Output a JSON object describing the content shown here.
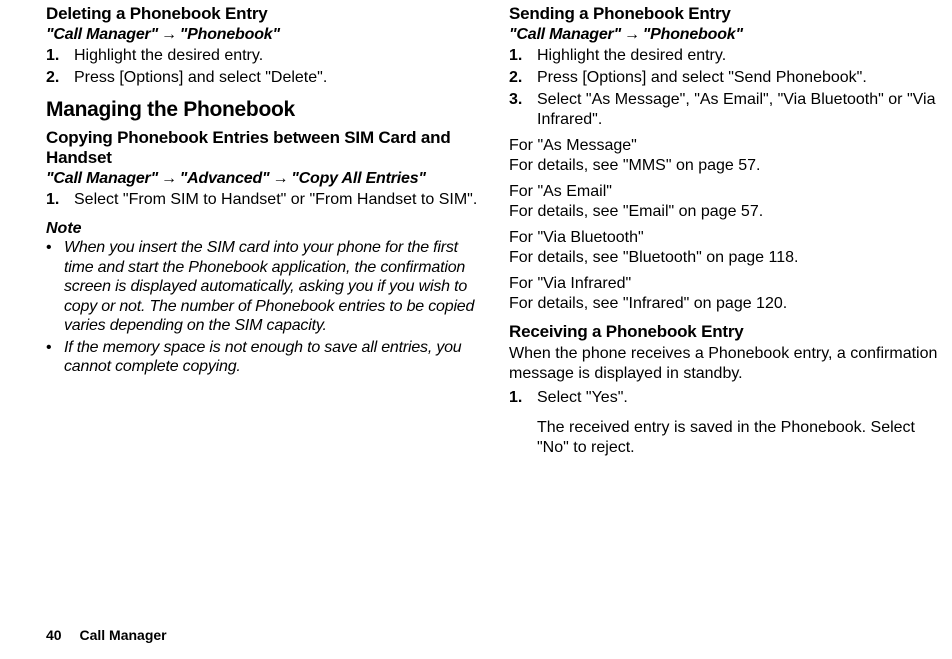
{
  "left": {
    "deleting": {
      "heading": "Deleting a Phonebook Entry",
      "crumb1": "\"Call Manager\"",
      "crumb2": "\"Phonebook\"",
      "steps": [
        {
          "n": "1.",
          "t": "Highlight the desired entry."
        },
        {
          "n": "2.",
          "t": "Press [Options] and select \"Delete\"."
        }
      ]
    },
    "managing": {
      "heading": "Managing the Phonebook",
      "sub": "Copying Phonebook Entries between SIM Card and Handset",
      "crumb1": "\"Call Manager\"",
      "crumb2": "\"Advanced\"",
      "crumb3": "\"Copy All Entries\"",
      "steps": [
        {
          "n": "1.",
          "t": "Select \"From SIM to Handset\" or \"From Handset to SIM\"."
        }
      ],
      "note_label": "Note",
      "notes": [
        "When you insert the SIM card into your phone for the first time and start the Phonebook application, the confirmation screen is displayed automatically, asking you if you wish to copy or not. The number of Phonebook entries to be copied varies depending on the SIM capacity.",
        "If the memory space is not enough to save all entries, you cannot complete copying."
      ]
    }
  },
  "right": {
    "sending": {
      "heading": "Sending a Phonebook Entry",
      "crumb1": "\"Call Manager\"",
      "crumb2": "\"Phonebook\"",
      "steps": [
        {
          "n": "1.",
          "t": "Highlight the desired entry."
        },
        {
          "n": "2.",
          "t": "Press [Options] and select \"Send Phonebook\"."
        },
        {
          "n": "3.",
          "t": "Select \"As Message\", \"As Email\", \"Via Bluetooth\" or \"Via Infrared\"."
        }
      ],
      "for": [
        {
          "t": "For \"As Message\"",
          "d": "For details, see \"MMS\" on page 57."
        },
        {
          "t": "For \"As Email\"",
          "d": "For details, see \"Email\" on page 57."
        },
        {
          "t": "For \"Via Bluetooth\"",
          "d": "For details, see \"Bluetooth\" on page 118."
        },
        {
          "t": "For \"Via Infrared\"",
          "d": "For details, see \"Infrared\" on page 120."
        }
      ]
    },
    "receiving": {
      "heading": "Receiving a Phonebook Entry",
      "intro": "When the phone receives a Phonebook entry, a confirmation message is displayed in standby.",
      "steps": [
        {
          "n": "1.",
          "t": "Select \"Yes\".",
          "sub": "The received entry is saved in the Phonebook. Select \"No\" to reject."
        }
      ]
    }
  },
  "footer": {
    "page": "40",
    "title": "Call Manager"
  },
  "arrow": "→"
}
